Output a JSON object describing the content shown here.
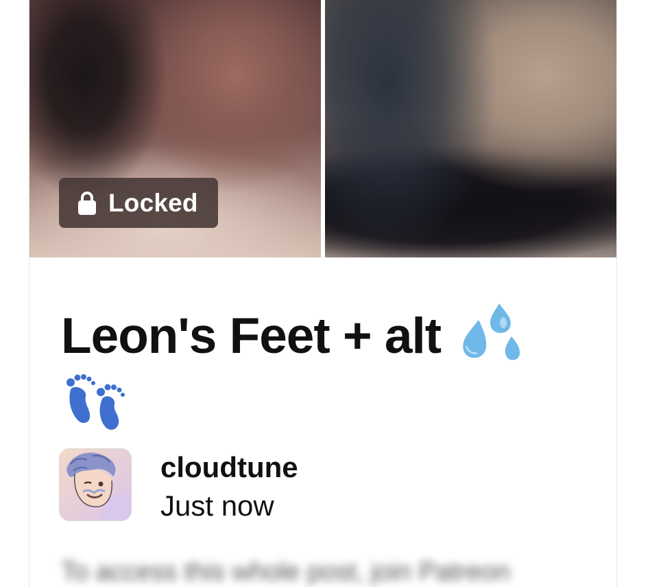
{
  "post": {
    "locked_label": "Locked",
    "title": "Leon's Feet + alt",
    "title_emoji": [
      "sweat-droplets-icon",
      "footprints-icon"
    ],
    "author": {
      "name": "cloudtune",
      "time": "Just now",
      "avatar": "avatar-illustration"
    },
    "blurred_body": "To access this whole post, join Patreon"
  },
  "colors": {
    "badge_bg": "#463734",
    "text": "#111111",
    "droplet_blue": "#6fb8e8",
    "footprint_blue": "#3f6fcf"
  }
}
